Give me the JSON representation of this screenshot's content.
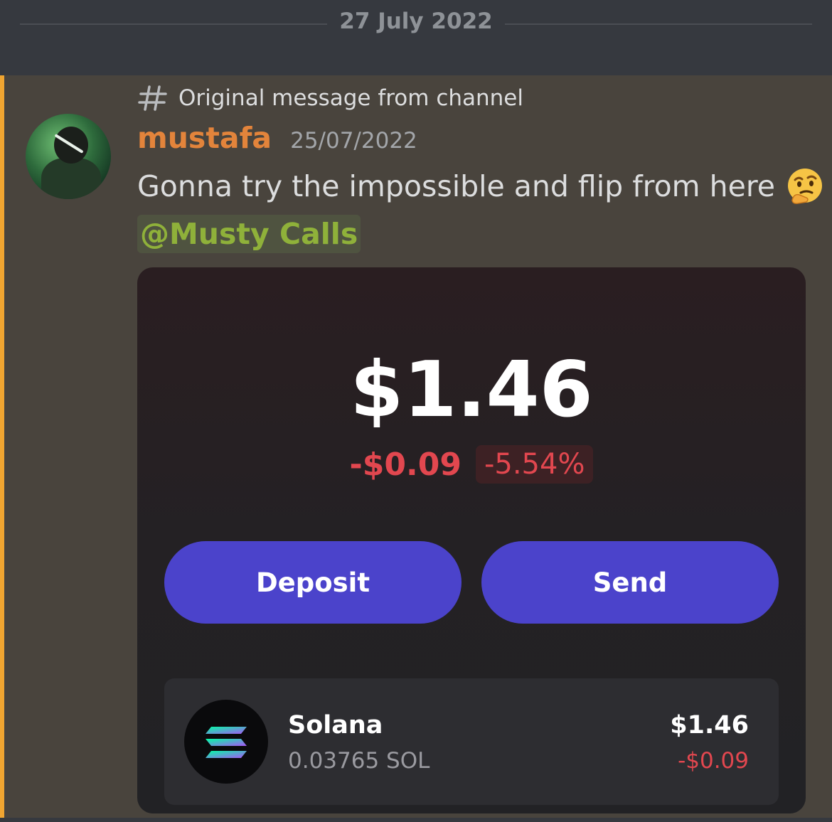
{
  "date_divider": {
    "label": "27 July 2022"
  },
  "message": {
    "reference": "Original message from channel",
    "author": "mustafa",
    "timestamp": "25/07/2022",
    "text": "Gonna try the impossible and flip from here",
    "emoji": "thinking-face",
    "mention": "@Musty Calls",
    "accent_color": "#f0a531",
    "author_color": "#e3843b"
  },
  "wallet": {
    "balance": "$1.46",
    "change_amount": "-$0.09",
    "change_percent": "-5.54%",
    "deposit_label": "Deposit",
    "send_label": "Send",
    "button_color": "#4b43cb",
    "negative_color": "#e2474f",
    "token": {
      "name": "Solana",
      "amount": "0.03765 SOL",
      "value": "$1.46",
      "change": "-$0.09",
      "icon": "solana-logo"
    }
  }
}
